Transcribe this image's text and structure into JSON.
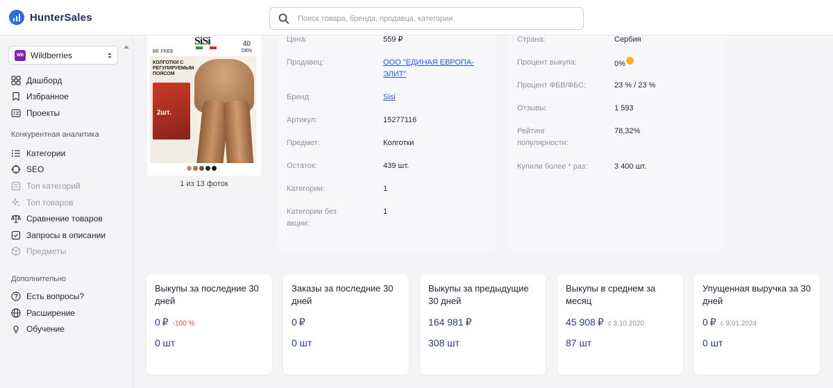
{
  "app": {
    "name": "HunterSales"
  },
  "search": {
    "placeholder": "Поиск товара, бренда, продавца, категории"
  },
  "marketplace": {
    "badge": "WB",
    "label": "Wildberries"
  },
  "sidebar": {
    "main": [
      {
        "label": "Дашборд",
        "icon": "dashboard-icon"
      },
      {
        "label": "Избранное",
        "icon": "bookmark-icon"
      },
      {
        "label": "Проекты",
        "icon": "projects-icon"
      }
    ],
    "competitive_title": "Конкурентная аналитика",
    "competitive": [
      {
        "label": "Категории",
        "icon": "list-icon",
        "disabled": false
      },
      {
        "label": "SEO",
        "icon": "target-icon",
        "disabled": false
      },
      {
        "label": "Топ категорий",
        "icon": "top-categories-icon",
        "disabled": true
      },
      {
        "label": "Топ товаров",
        "icon": "sparkle-icon",
        "disabled": true
      },
      {
        "label": "Сравнение товаров",
        "icon": "compare-icon",
        "disabled": false
      },
      {
        "label": "Запросы в описании",
        "icon": "queries-icon",
        "disabled": false
      },
      {
        "label": "Предметы",
        "icon": "cube-icon",
        "disabled": true
      }
    ],
    "extra_title": "Дополнительно",
    "extra": [
      {
        "label": "Есть вопросы?",
        "icon": "question-icon"
      },
      {
        "label": "Расширение",
        "icon": "globe-icon"
      },
      {
        "label": "Обучение",
        "icon": "bulb-icon"
      }
    ]
  },
  "product": {
    "photo_count": "1 из 13 фоток",
    "image": {
      "brand": "SiSi",
      "tagline": "BE FREE",
      "den_value": "40",
      "den_unit": "DEN",
      "title": "КОЛГОТКИ С РЕГУЛИРУЕМЫМ ПОЯСОМ",
      "pack": "2шт."
    },
    "swatch_colors": [
      "#b8926e",
      "#9a7556",
      "#6f523f",
      "#2e2b2e",
      "#0f0f12"
    ]
  },
  "info_left": [
    {
      "label": "Цена:",
      "value": "559 ₽"
    },
    {
      "label": "Продавец:",
      "value": "ООО \"ЕДИНАЯ ЕВРОПА-ЭЛИТ\"",
      "link": true
    },
    {
      "label": "Бренд:",
      "value": "Sisi",
      "link": true
    },
    {
      "label": "Артикул:",
      "value": "15277116"
    },
    {
      "label": "Предмет:",
      "value": "Колготки"
    },
    {
      "label": "Остаток:",
      "value": "439 шт."
    },
    {
      "label": "Категории:",
      "value": "1"
    },
    {
      "label": "Категории без акции:",
      "value": "1"
    }
  ],
  "info_right": [
    {
      "label": "Страна:",
      "value": "Сербия"
    },
    {
      "label": "Процент выкупа:",
      "value": "0%",
      "warning": true
    },
    {
      "label": "Процент ФБВ/ФБС:",
      "value": "23 % / 23 %"
    },
    {
      "label": "Отзывы:",
      "value": "1 593"
    },
    {
      "label": "Рейтинг популярности:",
      "value": "78,32%"
    },
    {
      "label": "Купили более * раз:",
      "value": "3 400 шт."
    }
  ],
  "stats": [
    {
      "title": "Выкупы за последние 30 дней",
      "value": "0",
      "currency": "₽",
      "note": "-100 %",
      "note_color": "red",
      "qty": "0 шт"
    },
    {
      "title": "Заказы за последние 30 дней",
      "value": "0",
      "currency": "₽",
      "note": "",
      "qty": "0 шт"
    },
    {
      "title": "Выкупы за предыдущие 30 дней",
      "value": "164 981",
      "currency": "₽",
      "note": "",
      "qty": "308 шт"
    },
    {
      "title": "Выкупы в среднем за месяц",
      "value": "45 908",
      "currency": "₽",
      "note": "с 3.10.2020",
      "qty": "87 шт"
    },
    {
      "title": "Упущенная выручка за 30 дней",
      "value": "0",
      "currency": "₽",
      "note": "с 9.01.2024",
      "qty": "0 шт"
    }
  ],
  "colors": {
    "accent": "#2a5bd7",
    "brand": "#2d6bd8",
    "warning": "#f5b21e",
    "negative": "#e04444",
    "value": "#2a3a7a"
  }
}
